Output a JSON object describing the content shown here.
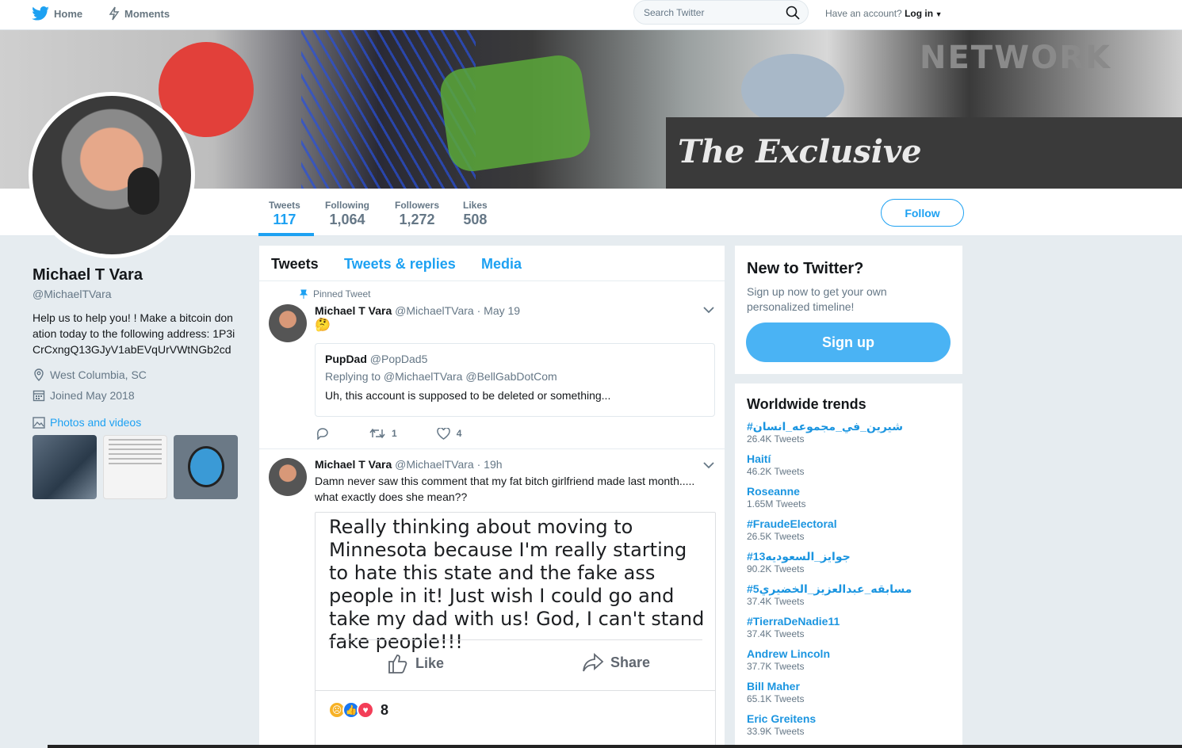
{
  "nav": {
    "home": "Home",
    "moments": "Moments",
    "search_placeholder": "Search Twitter",
    "have_account": "Have an account?",
    "login": "Log in"
  },
  "banner": {
    "title": "The Exclusive",
    "network": "NETWORK"
  },
  "stats": [
    {
      "label": "Tweets",
      "value": "117"
    },
    {
      "label": "Following",
      "value": "1,064"
    },
    {
      "label": "Followers",
      "value": "1,272"
    },
    {
      "label": "Likes",
      "value": "508"
    }
  ],
  "follow_label": "Follow",
  "profile": {
    "name": "Michael T Vara",
    "handle": "@MichaelTVara",
    "bio": "Help us to help you! ! Make a bitcoin donation today to the following address: 1P3iCrCxngQ13GJyV1abEVqUrVWtNGb2cd",
    "location": "West Columbia, SC",
    "joined": "Joined May 2018",
    "photos_link": "Photos and videos"
  },
  "tabs": [
    "Tweets",
    "Tweets & replies",
    "Media"
  ],
  "tweets": [
    {
      "pinned": "Pinned Tweet",
      "name": "Michael T Vara",
      "meta": "@MichaelTVara · May 19",
      "text": "🤔",
      "quote": {
        "name": "PupDad",
        "handle": "@PopDad5",
        "replying": "Replying to @MichaelTVara @BellGabDotCom",
        "text": "Uh, this account is supposed to be deleted or something..."
      },
      "retweets": "1",
      "likes": "4"
    },
    {
      "name": "Michael T Vara",
      "meta": "@MichaelTVara · 19h",
      "text": "Damn never saw this comment that my fat bitch girlfriend made last month..... what exactly does she mean??",
      "image": {
        "text": "Really thinking about moving to Minnesota because I'm really starting to hate this state and the fake ass people in it! Just wish I could go and take my dad with us! God, I can't stand fake people!!!",
        "like": "Like",
        "share": "Share",
        "reactions": "8"
      }
    }
  ],
  "new_to_twitter": {
    "title": "New to Twitter?",
    "desc": "Sign up now to get your own personalized timeline!",
    "signup": "Sign up"
  },
  "trends": {
    "title": "Worldwide trends",
    "items": [
      {
        "name": "#شيرين_في_مجموعه_انسان",
        "count": "26.4K Tweets"
      },
      {
        "name": "Haití",
        "count": "46.2K Tweets"
      },
      {
        "name": "Roseanne",
        "count": "1.65M Tweets"
      },
      {
        "name": "#FraudeElectoral",
        "count": "26.5K Tweets"
      },
      {
        "name": "#جوايز_السعوديه13",
        "count": "90.2K Tweets"
      },
      {
        "name": "#مسابقه_عبدالعزيز_الخضيري5",
        "count": "37.4K Tweets"
      },
      {
        "name": "#TierraDeNadie11",
        "count": "37.4K Tweets"
      },
      {
        "name": "Andrew Lincoln",
        "count": "37.7K Tweets"
      },
      {
        "name": "Bill Maher",
        "count": "65.1K Tweets"
      },
      {
        "name": "Eric Greitens",
        "count": "33.9K Tweets"
      }
    ]
  },
  "colors": {
    "accent": "#1da1f2",
    "signup": "#4ab3f4",
    "background": "#e6ecf0"
  }
}
